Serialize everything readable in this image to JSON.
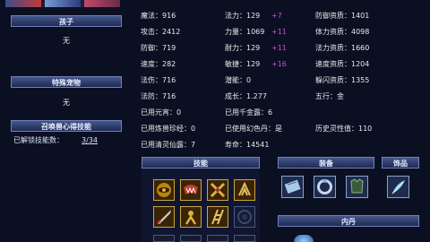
{
  "left": {
    "child_header": "孩子",
    "child_value": "无",
    "pet_header": "特殊宠物",
    "pet_value": "无",
    "skill_header": "召唤兽心得技能",
    "unlocked_label": "已解锁技能数：",
    "unlocked_value": "3/34"
  },
  "stats": {
    "col1": [
      {
        "label": "魔法：",
        "value": "916"
      },
      {
        "label": "攻击：",
        "value": "2412"
      },
      {
        "label": "防御：",
        "value": "719"
      },
      {
        "label": "速度：",
        "value": "282"
      },
      {
        "label": "法伤：",
        "value": "716"
      },
      {
        "label": "法防：",
        "value": "716"
      }
    ],
    "col2": [
      {
        "label": "法力：",
        "value": "129",
        "bonus": "+7"
      },
      {
        "label": "力量：",
        "value": "1069",
        "bonus": "+11"
      },
      {
        "label": "耐力：",
        "value": "129",
        "bonus": "+11"
      },
      {
        "label": "敏捷：",
        "value": "129",
        "bonus": "+16"
      },
      {
        "label": "潜能：",
        "value": "0",
        "bonus": ""
      },
      {
        "label": "成长：",
        "value": "1.277",
        "bonus": ""
      }
    ],
    "col3": [
      {
        "label": "防御资质：",
        "value": "1401"
      },
      {
        "label": "体力资质：",
        "value": "4098"
      },
      {
        "label": "法力资质：",
        "value": "1660"
      },
      {
        "label": "速度资质：",
        "value": "1204"
      },
      {
        "label": "躲闪资质：",
        "value": "1355"
      },
      {
        "label": "五行：",
        "value": "金"
      }
    ],
    "extra": {
      "yuanxiao": "已用元宵：0",
      "qianjinlu": "已用千金露：6",
      "lianshou": "已用炼兽珍经：0",
      "huanse": "已使用幻色丹：是",
      "lingxing": "历史灵性值：110",
      "qingling": "已用清灵仙露：7",
      "shouming": "寿命：14541"
    }
  },
  "sections": {
    "skills": "技能",
    "equipment": "装备",
    "ornament": "饰品",
    "neidan": "内丹"
  },
  "colors": {
    "bonus": "#d24bd8",
    "header_bg": "#2e3d6e",
    "slot_gold": "#c9a640"
  }
}
